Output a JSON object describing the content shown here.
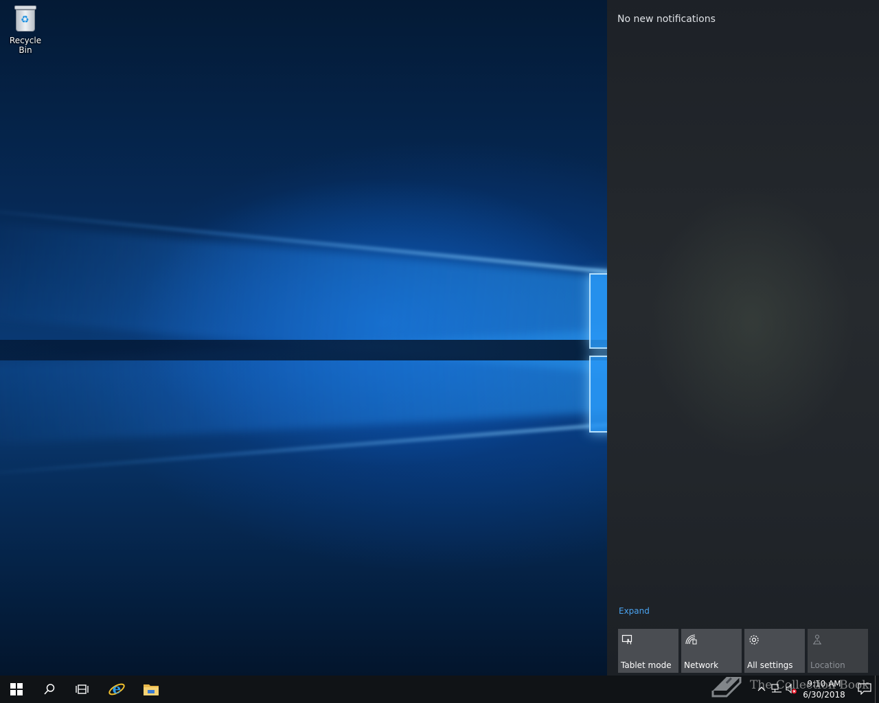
{
  "desktop": {
    "icons": [
      {
        "label": "Recycle Bin",
        "icon": "recycle-bin-icon"
      }
    ]
  },
  "action_center": {
    "title": "No new notifications",
    "expand_label": "Expand",
    "quick_actions": [
      {
        "label": "Tablet mode",
        "icon": "tablet-mode-icon",
        "enabled": true
      },
      {
        "label": "Network",
        "icon": "network-icon",
        "enabled": true
      },
      {
        "label": "All settings",
        "icon": "gear-icon",
        "enabled": true
      },
      {
        "label": "Location",
        "icon": "location-icon",
        "enabled": false
      }
    ]
  },
  "taskbar": {
    "pinned": [
      {
        "name": "start",
        "icon": "windows-logo-icon"
      },
      {
        "name": "search",
        "icon": "search-icon"
      },
      {
        "name": "task-view",
        "icon": "task-view-icon"
      },
      {
        "name": "internet-explorer",
        "icon": "internet-explorer-icon"
      },
      {
        "name": "file-explorer",
        "icon": "folder-icon"
      }
    ],
    "tray": {
      "time": "9:10 AM",
      "date": "6/30/2018",
      "icons": [
        "chevron-up-icon",
        "network-icon",
        "volume-muted-icon",
        "notification-icon"
      ]
    }
  },
  "watermark": {
    "text": "The Collection Book"
  },
  "colors": {
    "taskbar": "#101316",
    "action_center_bg": "#22262b",
    "tile_bg": "#4a4d52",
    "tile_disabled_bg": "#3c3f43",
    "link": "#4aa3f0"
  }
}
